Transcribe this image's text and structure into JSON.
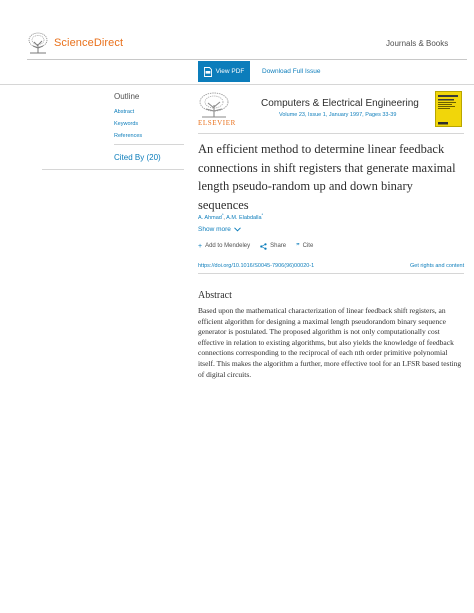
{
  "header": {
    "brand": "ScienceDirect",
    "journals_books": "Journals & Books"
  },
  "toolbar": {
    "view_pdf": "View PDF",
    "download_issue": "Download Full Issue"
  },
  "outline": {
    "title": "Outline",
    "items": [
      "Abstract",
      "Keywords",
      "References"
    ],
    "cited_by": "Cited By (20)"
  },
  "journal": {
    "publisher": "ELSEVIER",
    "name": "Computers & Electrical Engineering",
    "volume_info": "Volume 23, Issue 1, January 1997, Pages 33-39"
  },
  "article": {
    "title": "An efficient method to determine linear feedback connections in shift registers that generate maximal length pseudo-random up and down binary sequences",
    "authors": [
      "A. Ahmad",
      "A.M. Elabdalla"
    ],
    "show_more": "Show more",
    "actions": {
      "add_to_mendeley": "Add to Mendeley",
      "share": "Share",
      "cite": "Cite"
    },
    "doi": "https://doi.org/10.1016/S0045-7906(96)00020-1",
    "rights": "Get rights and content"
  },
  "abstract": {
    "heading": "Abstract",
    "text": "Based upon the mathematical characterization of linear feedback shift registers, an efficient algorithm for designing a maximal length pseudorandom binary sequence generator is postulated. The proposed algorithm is not only computationally cost effective in relation to existing algorithms, but also yields the knowledge of feedback connections corresponding to the reciprocal of each nth order primitive polynomial itself. This makes the algorithm a further, more effective tool for an LFSR based testing of digital circuits."
  },
  "colors": {
    "brand_orange": "#e9711c",
    "link_blue": "#0c7dbb",
    "cover_yellow": "#f1d60a"
  },
  "icons": [
    "elsevier-tree-logo",
    "pdf-icon",
    "chevron-down-icon",
    "plus-icon",
    "share-icon",
    "quote-icon"
  ]
}
